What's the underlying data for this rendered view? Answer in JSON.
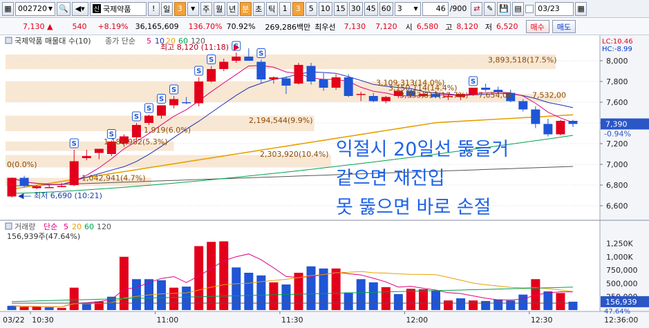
{
  "toolbar": {
    "code": "002720",
    "name": "국제약품",
    "period_buttons": [
      "일",
      "3",
      "주",
      "월",
      "년",
      "분",
      "초",
      "틱",
      "1",
      "3",
      "5",
      "10",
      "15",
      "30",
      "45",
      "60"
    ],
    "active_periods": [
      "3",
      "분",
      "3"
    ],
    "interval_value": "3",
    "count": "46",
    "count_total": "/900",
    "date": "03/23",
    "alert_label": "!"
  },
  "quote": {
    "price": "7,130",
    "arrow": "▲",
    "change": "540",
    "change_pct": "+8.19%",
    "volume": "36,165,609",
    "volume_ratio": "136.70%",
    "strength": "70.92%",
    "trade_value": "269,286백만",
    "best_sell_label": "최우선",
    "best_sell": "7,130",
    "best_buy": "7,120",
    "open_label": "시",
    "open": "6,580",
    "high_label": "고",
    "high": "8,120",
    "low_label": "저",
    "low": "6,520",
    "buy_button": "매수",
    "sell_button": "매도"
  },
  "price_chart": {
    "title": "국제약품 매물대 수(10)",
    "legend_label": "종가 단순",
    "ma_periods": [
      "5",
      "10",
      "20",
      "60",
      "120"
    ],
    "ma_colors": [
      "#e0007e",
      "#1f2fb0",
      "#e8a000",
      "#00a04a",
      "#555555"
    ],
    "lc_label": "LC:10.46",
    "hc_label": "HC:-8.99",
    "high_marker": "최고 8,120 (11:18)",
    "low_marker": "최저 6,690 (10:21)",
    "current_price_box": "7,390",
    "current_pct_box": "-0.94%",
    "y_ticks": [
      "8,000",
      "7,800",
      "7,600",
      "7,400",
      "7,200",
      "7,000",
      "6,800",
      "6,600"
    ],
    "volume_profile": [
      {
        "label": "3,893,518(17.5%)",
        "value": 3893518
      },
      {
        "label": "3,109,313(14.0%)",
        "value": 3109313
      },
      {
        "label": "3,150,114(14.4%)",
        "value": 3150114
      },
      {
        "label": "3,933,817(17.7%)",
        "value": 3933817
      },
      {
        "label": "7,654,00",
        "value": 7654000
      },
      {
        "label": "7,532,00",
        "value": 7532000
      },
      {
        "label": "2,194,544(9.9%)",
        "value": 2194544
      },
      {
        "label": "1,919(6.0%)",
        "value": 1919
      },
      {
        "label": "1,186,982(5.3%)",
        "value": 1186982
      },
      {
        "label": "2,303,920(10.4%)",
        "value": 2303920
      },
      {
        "label": "0(0.0%)",
        "value": 0
      },
      {
        "label": "1,042,941(4.7%)",
        "value": 1042941
      }
    ],
    "annotation_lines": [
      "익절시 20일선 뚫을거",
      "같으면 재진입",
      "못 뚫으면 바로 손절"
    ],
    "signal_marker": "S"
  },
  "volume_chart": {
    "title": "거래량",
    "legend_label": "단순",
    "ma_periods": [
      "5",
      "20",
      "60",
      "120"
    ],
    "summary": "156,939주(47.64%)",
    "current_box": "156,939",
    "current_pct": "47.64%",
    "y_ticks": [
      "1,250K",
      "1,000K",
      "750,000",
      "500,000",
      "250,000"
    ]
  },
  "x_axis": {
    "date_label": "03/22",
    "time_ticks": [
      "10:30",
      "11:00",
      "11:30",
      "12:00",
      "12:30"
    ],
    "end_time": "12:36:00"
  },
  "chart_data": [
    {
      "type": "candlestick",
      "title": "국제약품 매물대 수(10)",
      "ylim": [
        6500,
        8100
      ],
      "candles": [
        {
          "o": 6690,
          "h": 6740,
          "l": 6680,
          "c": 6870
        },
        {
          "o": 6870,
          "h": 6890,
          "l": 6780,
          "c": 6790
        },
        {
          "o": 6770,
          "h": 6800,
          "l": 6760,
          "c": 6790
        },
        {
          "o": 6780,
          "h": 6810,
          "l": 6770,
          "c": 6780
        },
        {
          "o": 6790,
          "h": 6820,
          "l": 6780,
          "c": 6790
        },
        {
          "o": 6800,
          "h": 7140,
          "l": 6790,
          "c": 7030
        },
        {
          "o": 7060,
          "h": 7140,
          "l": 7040,
          "c": 7080
        },
        {
          "o": 7110,
          "h": 7150,
          "l": 7050,
          "c": 7150
        },
        {
          "o": 7100,
          "h": 7230,
          "l": 7080,
          "c": 7220
        },
        {
          "o": 7200,
          "h": 7290,
          "l": 7170,
          "c": 7270
        },
        {
          "o": 7260,
          "h": 7400,
          "l": 7240,
          "c": 7380
        },
        {
          "o": 7400,
          "h": 7480,
          "l": 7380,
          "c": 7470
        },
        {
          "o": 7470,
          "h": 7570,
          "l": 7440,
          "c": 7570
        },
        {
          "o": 7570,
          "h": 7660,
          "l": 7540,
          "c": 7630
        },
        {
          "o": 7600,
          "h": 7650,
          "l": 7580,
          "c": 7590
        },
        {
          "o": 7590,
          "h": 7840,
          "l": 7560,
          "c": 7800
        },
        {
          "o": 7800,
          "h": 7950,
          "l": 7790,
          "c": 7920
        },
        {
          "o": 7920,
          "h": 8020,
          "l": 7900,
          "c": 7990
        },
        {
          "o": 8000,
          "h": 8080,
          "l": 7980,
          "c": 8040
        },
        {
          "o": 8040,
          "h": 8120,
          "l": 8020,
          "c": 8000
        },
        {
          "o": 7990,
          "h": 8010,
          "l": 7780,
          "c": 7820
        },
        {
          "o": 7820,
          "h": 7850,
          "l": 7780,
          "c": 7840
        },
        {
          "o": 7830,
          "h": 7850,
          "l": 7680,
          "c": 7760
        },
        {
          "o": 7780,
          "h": 7980,
          "l": 7770,
          "c": 7960
        },
        {
          "o": 7950,
          "h": 7980,
          "l": 7770,
          "c": 7800
        },
        {
          "o": 7820,
          "h": 7880,
          "l": 7710,
          "c": 7740
        },
        {
          "o": 7740,
          "h": 7870,
          "l": 7720,
          "c": 7840
        },
        {
          "o": 7840,
          "h": 7870,
          "l": 7650,
          "c": 7660
        },
        {
          "o": 7670,
          "h": 7700,
          "l": 7610,
          "c": 7680
        },
        {
          "o": 7660,
          "h": 7690,
          "l": 7600,
          "c": 7610
        },
        {
          "o": 7610,
          "h": 7660,
          "l": 7590,
          "c": 7650
        },
        {
          "o": 7660,
          "h": 7710,
          "l": 7640,
          "c": 7710
        },
        {
          "o": 7710,
          "h": 7720,
          "l": 7640,
          "c": 7660
        },
        {
          "o": 7660,
          "h": 7700,
          "l": 7650,
          "c": 7680
        },
        {
          "o": 7680,
          "h": 7710,
          "l": 7640,
          "c": 7650
        },
        {
          "o": 7650,
          "h": 7680,
          "l": 7620,
          "c": 7660
        },
        {
          "o": 7650,
          "h": 7690,
          "l": 7620,
          "c": 7680
        },
        {
          "o": 7670,
          "h": 7740,
          "l": 7660,
          "c": 7740
        },
        {
          "o": 7740,
          "h": 7780,
          "l": 7700,
          "c": 7720
        },
        {
          "o": 7720,
          "h": 7750,
          "l": 7680,
          "c": 7700
        },
        {
          "o": 7690,
          "h": 7720,
          "l": 7600,
          "c": 7610
        },
        {
          "o": 7610,
          "h": 7630,
          "l": 7510,
          "c": 7530
        },
        {
          "o": 7530,
          "h": 7560,
          "l": 7350,
          "c": 7390
        },
        {
          "o": 7390,
          "h": 7440,
          "l": 7270,
          "c": 7290
        },
        {
          "o": 7290,
          "h": 7430,
          "l": 7280,
          "c": 7420
        },
        {
          "o": 7420,
          "h": 7430,
          "l": 7360,
          "c": 7390
        }
      ]
    },
    {
      "type": "bar",
      "title": "거래량",
      "ylim": [
        0,
        1400000
      ],
      "values": [
        80000,
        60000,
        60000,
        50000,
        40000,
        420000,
        120000,
        160000,
        250000,
        1000000,
        580000,
        580000,
        560000,
        420000,
        440000,
        1200000,
        1280000,
        1290000,
        800000,
        700000,
        650000,
        520000,
        480000,
        700000,
        820000,
        780000,
        780000,
        330000,
        580000,
        520000,
        430000,
        300000,
        400000,
        390000,
        360000,
        180000,
        220000,
        180000,
        170000,
        200000,
        180000,
        290000,
        580000,
        350000,
        320000,
        156939
      ],
      "colors_up_down": [
        "dn",
        "up",
        "up",
        "dn",
        "up",
        "up",
        "dn",
        "up",
        "dn",
        "up",
        "dn",
        "dn",
        "dn",
        "up",
        "dn",
        "up",
        "up",
        "up",
        "dn",
        "dn",
        "dn",
        "up",
        "dn",
        "up",
        "dn",
        "dn",
        "up",
        "dn",
        "dn",
        "dn",
        "up",
        "dn",
        "up",
        "up",
        "dn",
        "up",
        "dn",
        "up",
        "dn",
        "dn",
        "dn",
        "dn",
        "up",
        "dn",
        "up",
        "dn"
      ]
    }
  ]
}
